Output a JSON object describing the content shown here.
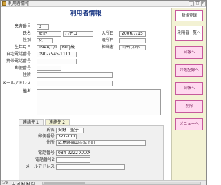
{
  "window": {
    "title": "利用者情報"
  },
  "form": {
    "title": "利用者情報",
    "labels": {
      "patient_no": "患者番号：",
      "name": "氏名：",
      "kana": "性別：",
      "birth": "生年月日：",
      "age_unit": "歳",
      "admission": "入所日：",
      "discharge": "退所日：",
      "staff": "担当者：",
      "home_phone": "自宅電話番号：",
      "mobile_phone": "携帯電話番号：",
      "postal": "郵便番号：",
      "address": "住所：",
      "email": "メールアドレス：",
      "remarks": "備考："
    },
    "values": {
      "patient_no": "3",
      "last_name": "安野",
      "first_name": "ハチコ",
      "gender": "女",
      "birth": "1948/1/1",
      "age": "60",
      "admission": "2006/7/15",
      "discharge": "",
      "staff_name": "山田 太郎",
      "home_phone": "090-7545-1111",
      "mobile_phone": "",
      "postal": "",
      "address": "",
      "email": ""
    }
  },
  "contacts": {
    "tabs": [
      "連絡先１",
      "連絡先２"
    ],
    "labels": {
      "name": "氏名",
      "postal": "郵便番号",
      "address": "住所",
      "phone": "電話番号",
      "phone2": "電話番号2",
      "email": "メールアドレス"
    },
    "values": {
      "name": "安野　聖子",
      "postal": "321-1111",
      "address": "広島県福山市城下町",
      "phone": "084-2222-XXXX",
      "phone2": "",
      "email": ""
    }
  },
  "sidebar": {
    "buttons": [
      "新規登録",
      "利用者一覧へ",
      "日報へ",
      "介護記録へ",
      "台帳へ",
      "削除",
      "メニューへ"
    ]
  },
  "status": {
    "record": "1/9"
  },
  "colors": {
    "title_blue": "#1f3b86",
    "sidebar_bg": "#f3f2d4",
    "button_border": "#c65a9b",
    "button_fill": "#ffd9ef"
  }
}
